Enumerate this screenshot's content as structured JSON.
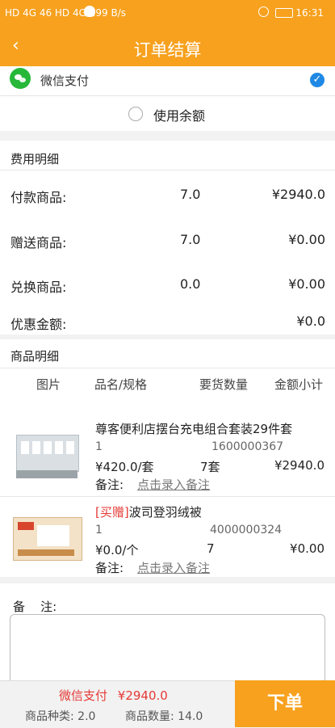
{
  "status_bar": {
    "left": "HD 4G 46 HD 4G 299 B/s",
    "time": "16:31"
  },
  "header": {
    "title": "订单结算",
    "back_symbol": "‹"
  },
  "payment": {
    "wechat_label": "微信支付",
    "balance_label": "使用余额"
  },
  "fees": {
    "section_title": "费用明细",
    "rows": [
      {
        "label": "付款商品:",
        "qty": "7.0",
        "amount": "¥2940.0"
      },
      {
        "label": "赠送商品:",
        "qty": "7.0",
        "amount": "¥0.00"
      },
      {
        "label": "兑换商品:",
        "qty": "0.0",
        "amount": "¥0.00"
      },
      {
        "label": "优惠金额:",
        "qty": "",
        "amount": "¥0.0"
      }
    ]
  },
  "goods": {
    "section_title": "商品明细",
    "headers": [
      "图片",
      "品名/规格",
      "要货数量",
      "金额小计"
    ],
    "items": [
      {
        "name": "尊客便利店摆台充电组合套装29件套",
        "spec": "1",
        "code": "1600000367",
        "unit_price": "¥420.0/套",
        "qty": "7套",
        "subtotal": "¥2940.0",
        "note_label": "备注:",
        "note_link": "点击录入备注"
      },
      {
        "tag": "[买赠]",
        "name": "波司登羽绒被",
        "spec": "1",
        "code": "4000000324",
        "unit_price": "¥0.0/个",
        "qty": "7",
        "subtotal": "¥0.00",
        "note_label": "备注:",
        "note_link": "点击录入备注"
      }
    ]
  },
  "remark": {
    "label": "备    注:"
  },
  "bottom": {
    "pay_method": "微信支付",
    "total": "¥2940.0",
    "kinds": "商品种类: 2.0",
    "count": "商品数量: 14.0",
    "order_button": "下单"
  },
  "colors": {
    "accent": "#f7a11e",
    "red": "#e53935",
    "wechat": "#27b83a",
    "check": "#1f88e5"
  }
}
